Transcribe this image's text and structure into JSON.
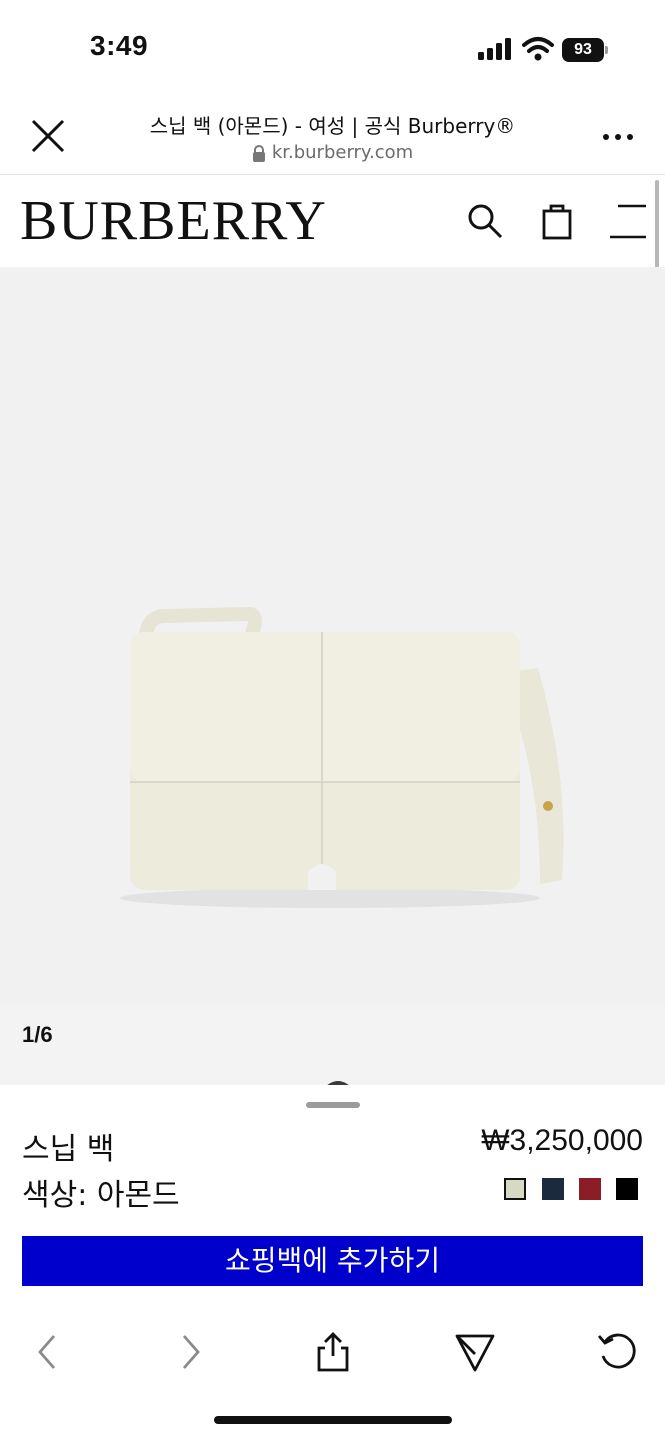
{
  "status_bar": {
    "time": "3:49",
    "battery": "93"
  },
  "browser": {
    "page_title": "스닙 백 (아몬드) - 여성 | 공식 Burberry®",
    "url": "kr.burberry.com"
  },
  "site": {
    "logo": "BURBERRY"
  },
  "gallery": {
    "counter": "1/6"
  },
  "product": {
    "name": "스닙 백",
    "price": "₩3,250,000",
    "color_label": "색상: 아몬드",
    "swatches": [
      {
        "color": "#d8d9c4",
        "selected": true
      },
      {
        "color": "#1c2a3d",
        "selected": false
      },
      {
        "color": "#8b1d26",
        "selected": false
      },
      {
        "color": "#000000",
        "selected": false
      }
    ],
    "add_to_bag_label": "쇼핑백에 추가하기"
  },
  "colors": {
    "accent": "#0000cc",
    "bag": "#ecebdc",
    "background": "#f1f1f1"
  },
  "toolbar": {
    "icons": [
      "back-icon",
      "forward-icon",
      "share-icon",
      "send-icon",
      "reload-icon"
    ]
  }
}
